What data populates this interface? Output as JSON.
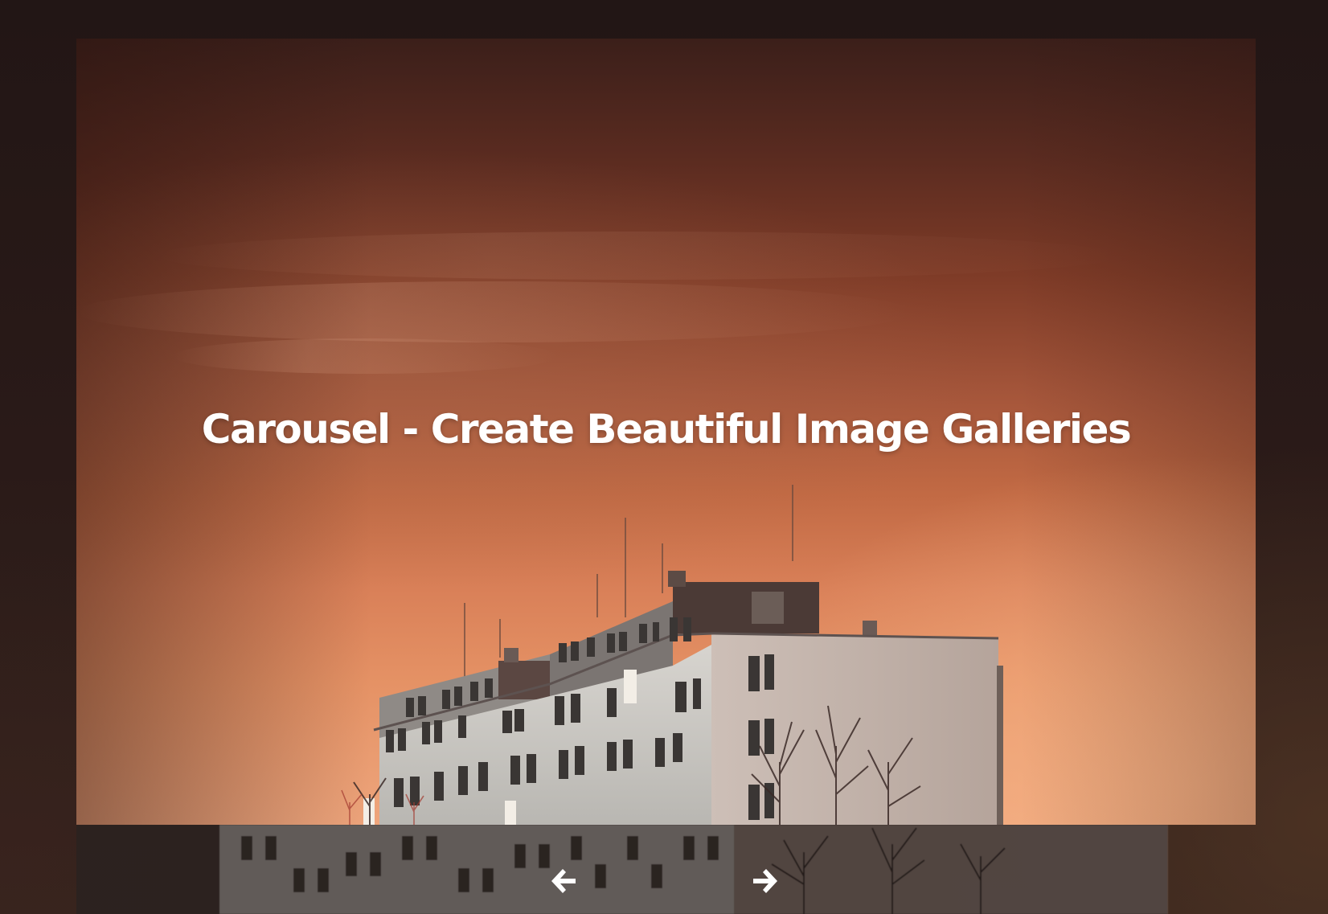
{
  "slide": {
    "title": "Carousel - Create Beautiful Image Galleries"
  },
  "controls": {
    "prev_icon": "arrow-left-icon",
    "next_icon": "arrow-right-icon"
  },
  "colors": {
    "title_text": "#ffffff",
    "page_background": "#231716",
    "sky_dark": "#3b1f1a",
    "sky_light": "#eea57c",
    "building_wall": "#c9c3bd"
  }
}
